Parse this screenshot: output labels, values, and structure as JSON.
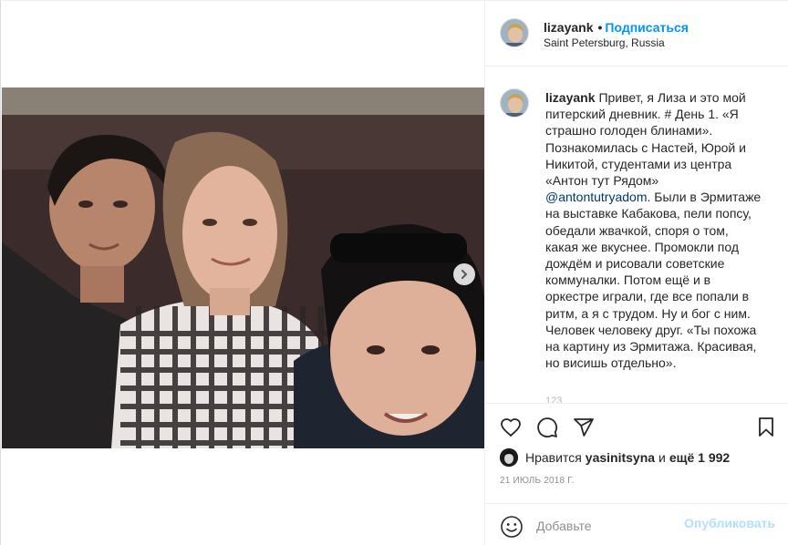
{
  "post": {
    "author": {
      "username": "lizayank",
      "location": "Saint Petersburg, Russia"
    },
    "follow_label": "Подписаться",
    "separator": "•",
    "caption": {
      "username": "lizayank",
      "text_part1": "Привет, я Лиза и это мой питерский дневник. # День 1. «Я страшно голоден блинами». Познакомилась с Настей, Юрой и Никитой, студентами из центра «Антон тут Рядом»",
      "mention": "@antontutryadom",
      "text_part2": ". Были в Эрмитаже на выставке Кабакова, пели попсу, обедали жвачкой, споря о том, какая же вкуснее. Промокли под дождём и рисовали советские коммуналки. Потом ещё и в оркестре играли, где все попали в ритм, а я с трудом. Ну и бог с ним. Человек человеку друг. «Ты похожа на картину из Эрмитажа. Красивая, но висишь отдельно».",
      "cut_text": "123"
    },
    "likes": {
      "prefix": "Нравится",
      "liker": "yasinitsyna",
      "middle": "и",
      "count_label": "ещё 1 992"
    },
    "date": "21 июль 2018 г.",
    "comment_box": {
      "placeholder": "Добавьте комментарий...",
      "placeholder_visible": "Добавьте",
      "publish_label": "Опубликовать"
    }
  },
  "icons": {
    "like": "heart-icon",
    "comment": "comment-icon",
    "share": "share-icon",
    "save": "bookmark-icon",
    "emoji": "smiley-icon",
    "next": "chevron-right-icon"
  },
  "colors": {
    "accent": "#0095f6",
    "publish_disabled": "#b2dffc",
    "mention": "#00376b",
    "muted": "#8e8e8e",
    "border": "#efefef"
  }
}
